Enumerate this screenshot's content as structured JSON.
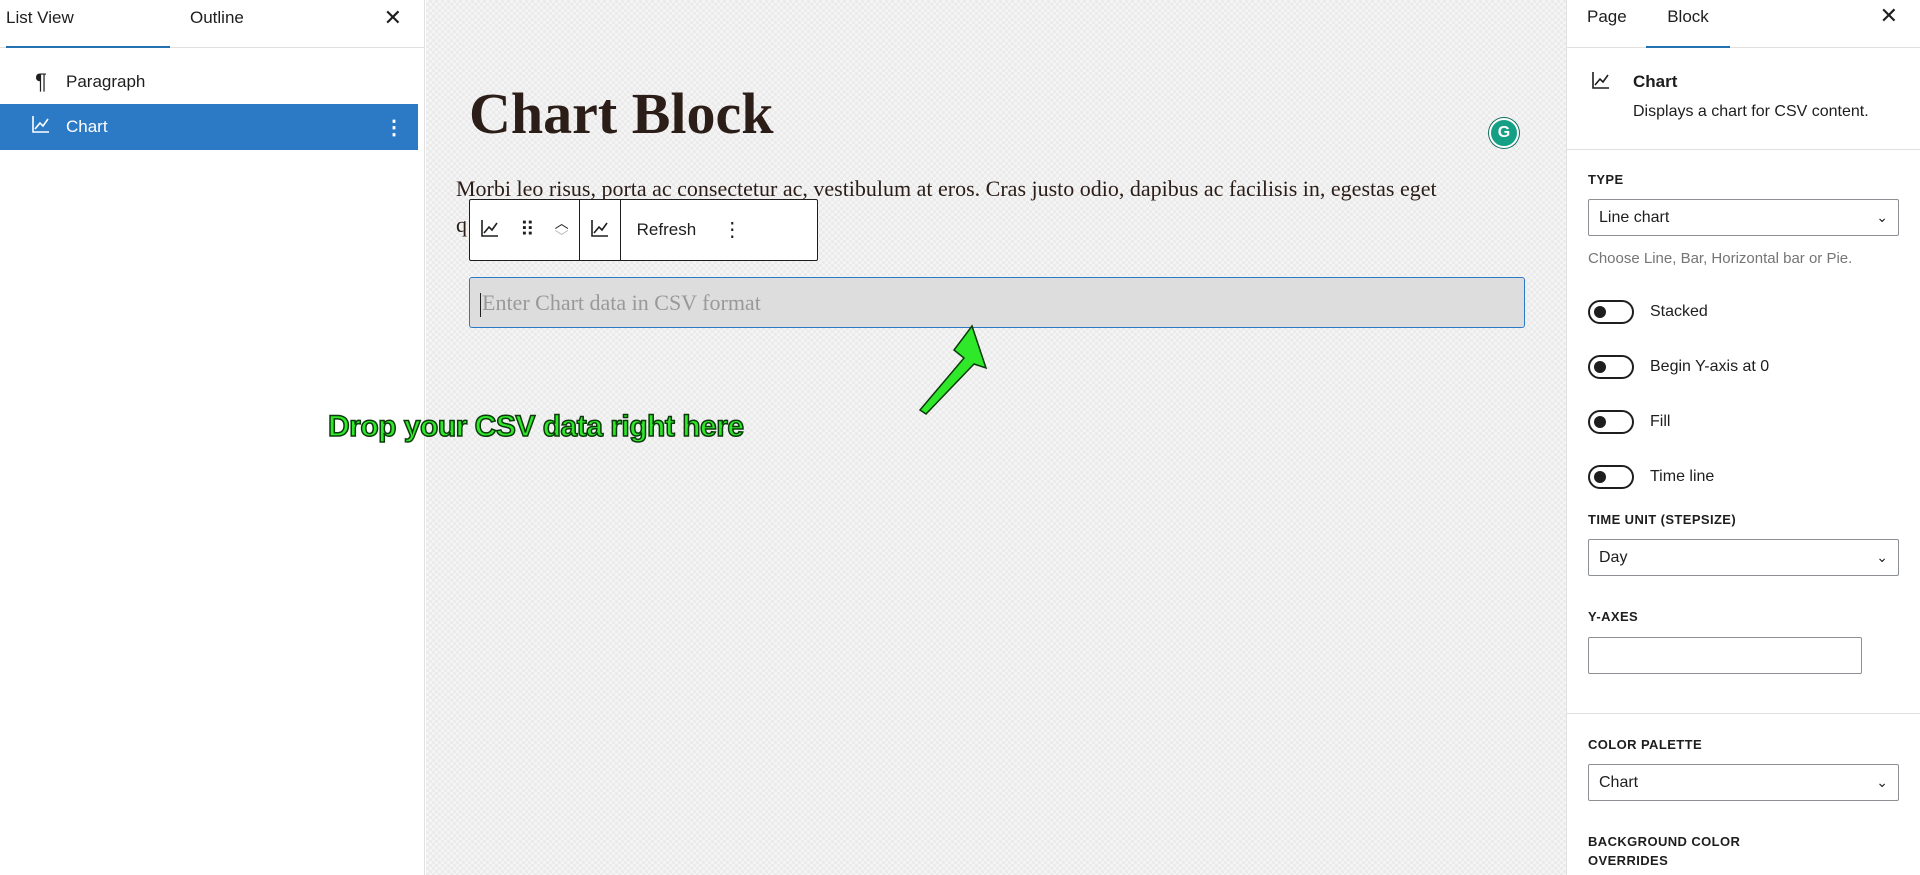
{
  "list_view": {
    "tabs": [
      "List View",
      "Outline"
    ],
    "items": [
      {
        "label": "Paragraph",
        "icon": "paragraph-icon"
      },
      {
        "label": "Chart",
        "icon": "chart-line-icon",
        "selected": true
      }
    ]
  },
  "canvas": {
    "title": "Chart Block",
    "paragraph_line1": "Morbi leo risus, porta ac consectetur ac, vestibulum at eros. Cras justo odio, dapibus ac facilisis in, egestas eget",
    "paragraph_line2_start": "q",
    "toolbar": {
      "refresh_label": "Refresh"
    },
    "csv_placeholder": "Enter Chart data in CSV format",
    "annotation": "Drop your CSV data right here",
    "grammarly_letter": "G"
  },
  "settings": {
    "tabs": [
      "Page",
      "Block"
    ],
    "block_name": "Chart",
    "block_description": "Displays a chart for CSV content.",
    "type_label": "TYPE",
    "type_value": "Line chart",
    "type_help": "Choose Line, Bar, Horizontal bar or Pie.",
    "toggles": [
      "Stacked",
      "Begin Y-axis at 0",
      "Fill",
      "Time line"
    ],
    "time_unit_label": "TIME UNIT (STEPSIZE)",
    "time_unit_value": "Day",
    "y_axes_label": "Y-AXES",
    "color_palette_label": "COLOR PALETTE",
    "color_palette_value": "Chart",
    "bg_overrides_label_1": "BACKGROUND COLOR",
    "bg_overrides_label_2": "OVERRIDES"
  },
  "colors": {
    "accent": "#2c7ac6",
    "annotation_green": "#2fe82a",
    "grammarly": "#15a085"
  }
}
